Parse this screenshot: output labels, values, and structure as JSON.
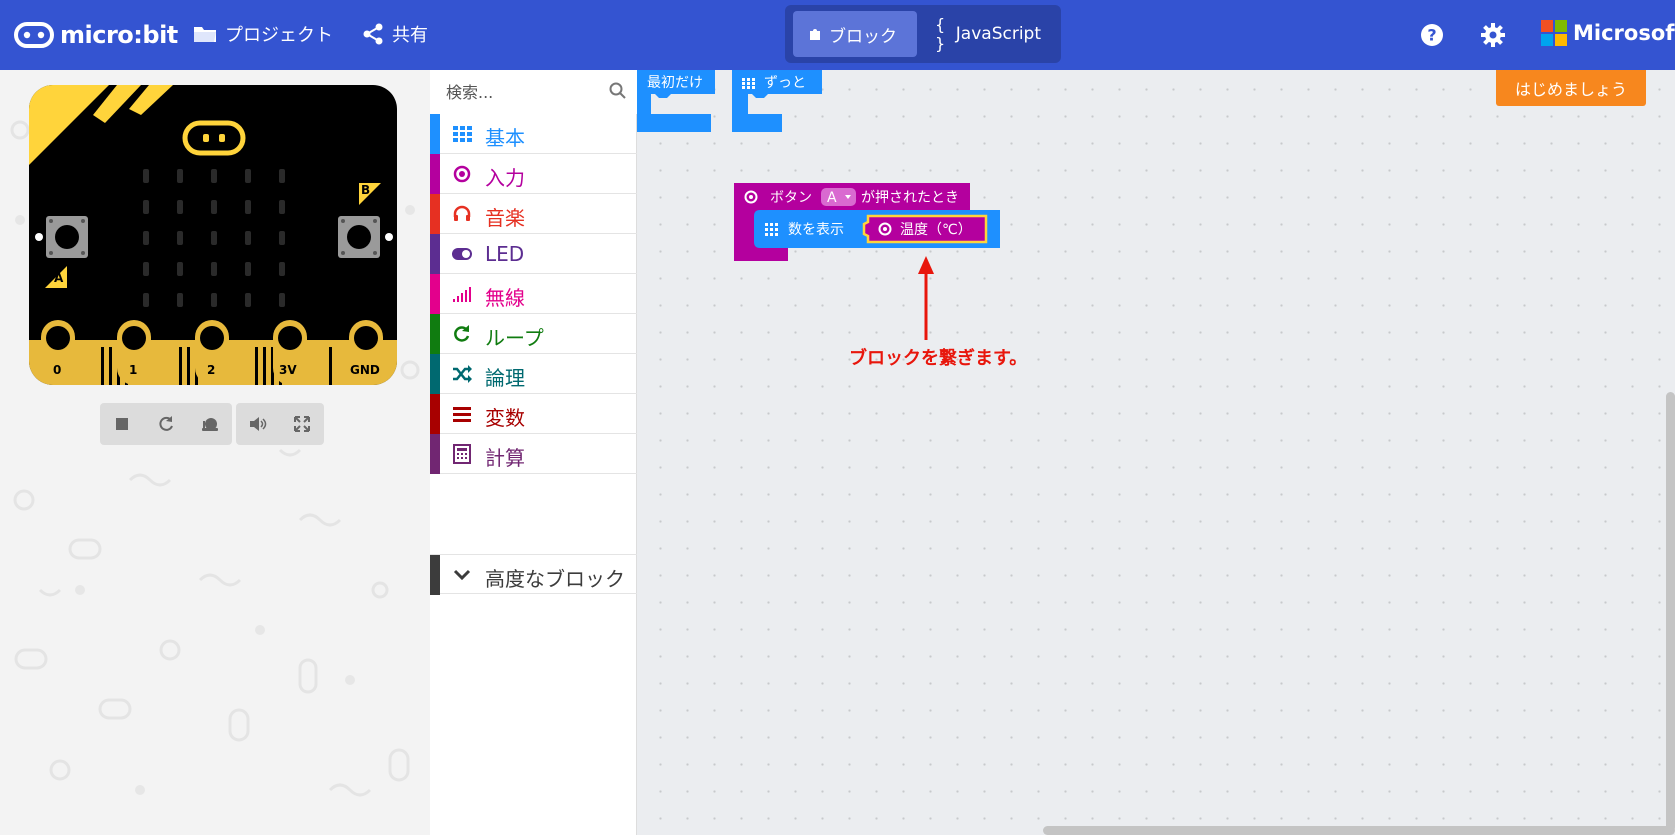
{
  "header": {
    "brand": "micro:bit",
    "projects_label": "プロジェクト",
    "share_label": "共有",
    "blocks_tab": "ブロック",
    "js_tab": "JavaScript",
    "microsoft": "Microsoft"
  },
  "simulator": {
    "pins": [
      "0",
      "1",
      "2",
      "3V",
      "GND"
    ],
    "button_a": "A",
    "button_b": "B"
  },
  "toolbox": {
    "search_placeholder": "検索...",
    "categories": [
      {
        "label": "基本",
        "color": "#1E90FF"
      },
      {
        "label": "入力",
        "color": "#C71585"
      },
      {
        "label": "音楽",
        "color": "#E63022"
      },
      {
        "label": "LED",
        "color": "#5C2D91"
      },
      {
        "label": "無線",
        "color": "#E3008C"
      },
      {
        "label": "ループ",
        "color": "#107C10"
      },
      {
        "label": "論理",
        "color": "#006970"
      },
      {
        "label": "変数",
        "color": "#A80000"
      },
      {
        "label": "計算",
        "color": "#712672"
      }
    ],
    "advanced_label": "高度なブロック"
  },
  "workspace": {
    "start_button": "はじめましょう",
    "block_on_start": "最初だけ",
    "block_forever": "ずっと",
    "event_block_prefix": "ボタン",
    "event_block_button": "A",
    "event_block_suffix": "が押されたとき",
    "show_number_label": "数を表示",
    "temperature_label": "温度（℃）",
    "annotation": "ブロックを繋ぎます。"
  },
  "colors": {
    "header": "#3454D1",
    "basic": "#1E90FF",
    "input": "#B4009E",
    "start_button": "#F7871E",
    "annotation": "#E8160C"
  }
}
